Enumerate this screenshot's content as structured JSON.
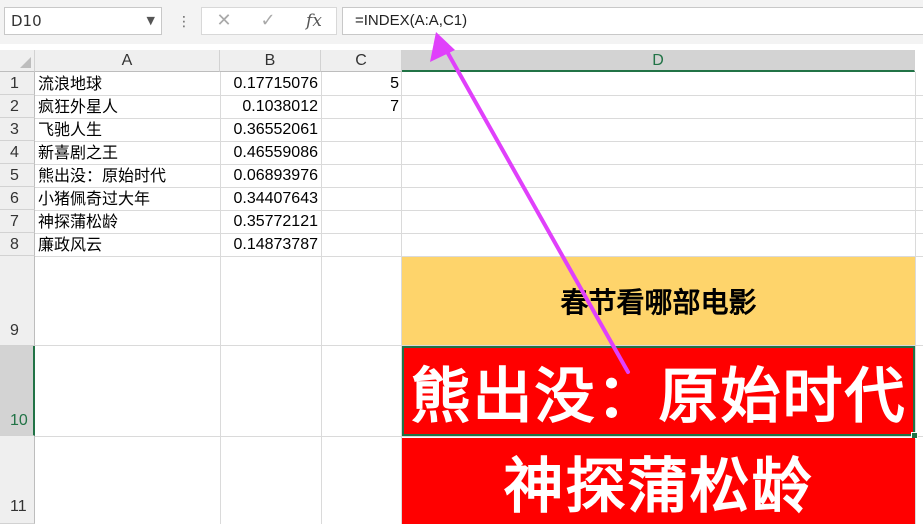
{
  "name_box": {
    "value": "D10"
  },
  "formula_bar": {
    "cancel": "✕",
    "enter": "✓",
    "fx": "fx",
    "formula": "=INDEX(A:A,C1)"
  },
  "columns": [
    "A",
    "B",
    "C",
    "D"
  ],
  "rows": [
    "1",
    "2",
    "3",
    "4",
    "5",
    "6",
    "7",
    "8",
    "9",
    "10",
    "11"
  ],
  "data_rows": [
    {
      "a": "流浪地球",
      "b": "0.17715076",
      "c": "5"
    },
    {
      "a": "疯狂外星人",
      "b": "0.1038012",
      "c": "7"
    },
    {
      "a": "飞驰人生",
      "b": "0.36552061",
      "c": ""
    },
    {
      "a": "新喜剧之王",
      "b": "0.46559086",
      "c": ""
    },
    {
      "a": "熊出没：原始时代",
      "b": "0.06893976",
      "c": ""
    },
    {
      "a": "小猪佩奇过大年",
      "b": "0.34407643",
      "c": ""
    },
    {
      "a": "神探蒲松龄",
      "b": "0.35772121",
      "c": ""
    },
    {
      "a": "廉政风云",
      "b": "0.14873787",
      "c": ""
    }
  ],
  "d9": "春节看哪部电影",
  "d10": "熊出没：原始时代",
  "d11": "神探蒲松龄",
  "colors": {
    "header_fill": "#fed46b",
    "result_fill": "#ff0000",
    "selection": "#217346",
    "arrow": "#e040fb"
  }
}
